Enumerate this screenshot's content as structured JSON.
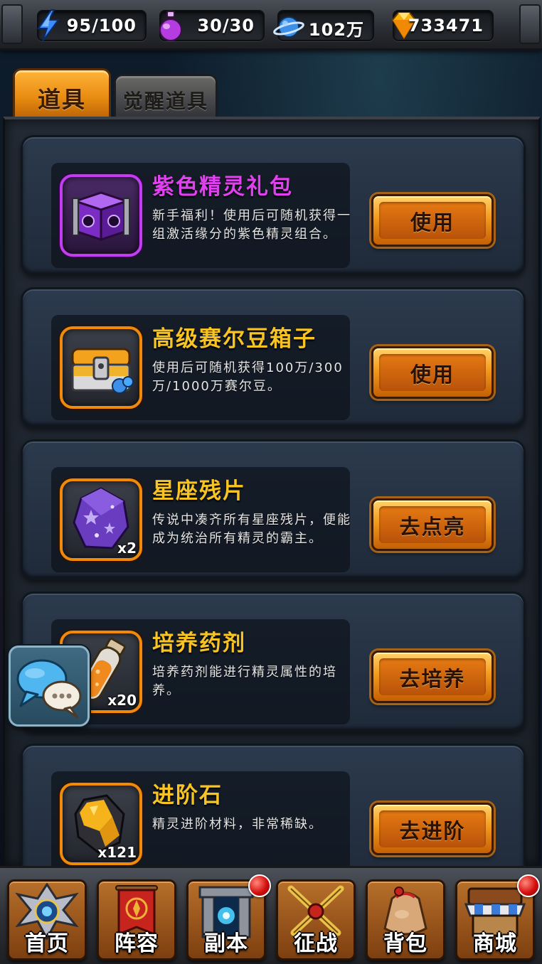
{
  "resources": {
    "energy": "95/100",
    "potion": "30/30",
    "bean": "102万",
    "gem": "733471"
  },
  "tabs": {
    "items": "道具",
    "awaken_items": "觉醒道具"
  },
  "items": [
    {
      "name": "紫色精灵礼包",
      "desc": "新手福利！使用后可随机获得一组激活缘分的紫色精灵组合。",
      "count": "",
      "button": "使用",
      "icon": "purple-chest-icon",
      "name_color": "#e040f0"
    },
    {
      "name": "高级赛尔豆箱子",
      "desc": "使用后可随机获得100万/300万/1000万赛尔豆。",
      "count": "",
      "button": "使用",
      "icon": "gold-chest-icon",
      "name_color": "#f7c424"
    },
    {
      "name": "星座残片",
      "desc": "传说中凑齐所有星座残片，便能成为统治所有精灵的霸主。",
      "count": "x2",
      "button": "去点亮",
      "icon": "star-crystal-icon",
      "name_color": "#f7c424"
    },
    {
      "name": "培养药剂",
      "desc": "培养药剂能进行精灵属性的培养。",
      "count": "x20",
      "button": "去培养",
      "icon": "potion-vial-icon",
      "name_color": "#f7c424"
    },
    {
      "name": "进阶石",
      "desc": "精灵进阶材料，非常稀缺。",
      "count": "x121",
      "button": "去进阶",
      "icon": "advance-stone-icon",
      "name_color": "#f7c424"
    }
  ],
  "nav": {
    "home": "首页",
    "lineup": "阵容",
    "dungeon": "副本",
    "campaign": "征战",
    "bag": "背包",
    "shop": "商城"
  },
  "colors": {
    "accent_orange": "#f39a1a",
    "item_name_gold": "#f7c424",
    "item_name_purple": "#e040f0",
    "notification_red": "#d40f0f"
  }
}
